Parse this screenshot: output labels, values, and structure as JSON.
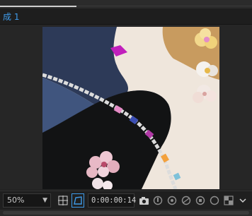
{
  "composition_tab": {
    "label": "成 1"
  },
  "toolbar": {
    "zoom_value": "50%",
    "timecode": "0:00:00:14"
  },
  "icons": [
    "zoom-dropdown-caret",
    "grid-guides-icon",
    "mask-path-visibility-icon",
    "snapshot-camera-icon",
    "show-snapshot-icon",
    "channel-icon",
    "color-management-icon",
    "resolution-icon"
  ],
  "colors": {
    "accent_blue": "#3f9be9",
    "panel_bg": "#232323"
  }
}
